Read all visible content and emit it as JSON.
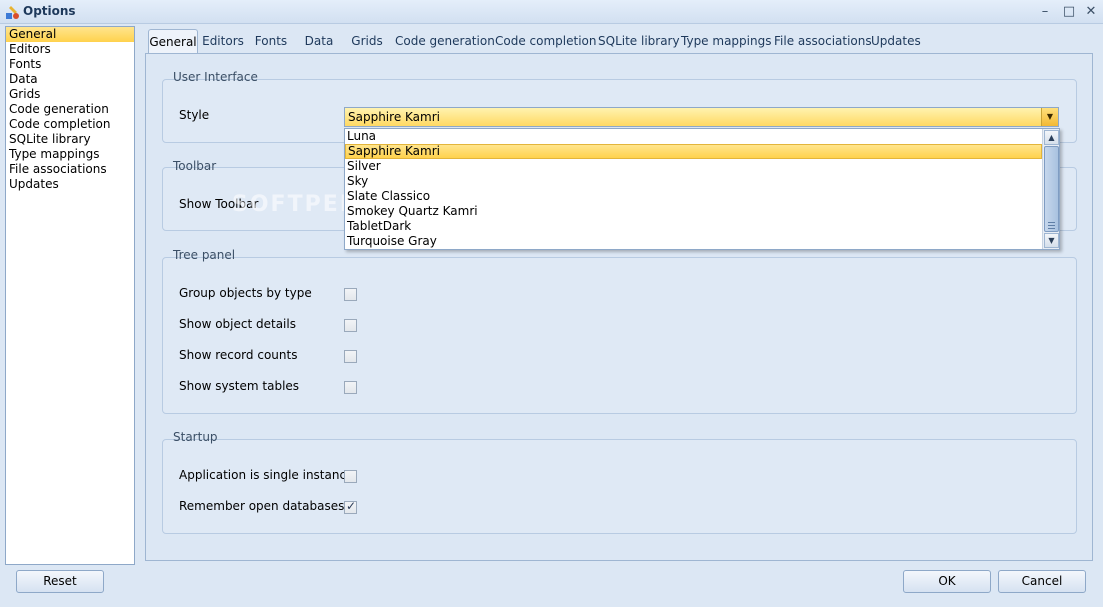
{
  "window": {
    "title": "Options",
    "controls": [
      "–",
      "□",
      "✕"
    ]
  },
  "tree": {
    "items": [
      "General",
      "Editors",
      "Fonts",
      "Data",
      "Grids",
      "Code generation",
      "Code completion",
      "SQLite library",
      "Type mappings",
      "File associations",
      "Updates"
    ],
    "selected_index": 0
  },
  "tabs": {
    "items": [
      "General",
      "Editors",
      "Fonts",
      "Data",
      "Grids",
      "Code generation",
      "Code completion",
      "SQLite library",
      "Type mappings",
      "File associations",
      "Updates"
    ],
    "active_index": 0
  },
  "user_interface": {
    "group_title": "User Interface",
    "style_label": "Style",
    "style_value": "Sapphire Kamri",
    "dropdown_options": [
      "Luna",
      "Sapphire Kamri",
      "Silver",
      "Sky",
      "Slate Classico",
      "Smokey Quartz Kamri",
      "TabletDark",
      "Turquoise Gray"
    ],
    "dropdown_selected_index": 1
  },
  "toolbar": {
    "group_title": "Toolbar",
    "show_toolbar_label": "Show Toolbar"
  },
  "tree_panel": {
    "group_title": "Tree panel",
    "options": [
      {
        "label": "Group objects by type",
        "checked": false
      },
      {
        "label": "Show object details",
        "checked": false
      },
      {
        "label": "Show record counts",
        "checked": false
      },
      {
        "label": "Show system tables",
        "checked": false
      }
    ]
  },
  "startup": {
    "group_title": "Startup",
    "options": [
      {
        "label": "Application is single instance",
        "checked": false
      },
      {
        "label": "Remember open databases",
        "checked": true
      }
    ]
  },
  "buttons": {
    "reset": "Reset",
    "ok": "OK",
    "cancel": "Cancel"
  },
  "watermark": "SOFTPEDIA",
  "colors": {
    "selection": "#ffd24d",
    "frame": "#dce7f4",
    "border": "#8ea8c8"
  }
}
